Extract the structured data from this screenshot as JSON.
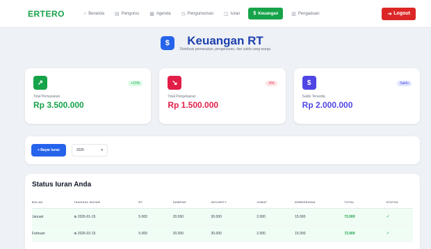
{
  "nav": {
    "brand": "ERTERO",
    "items": [
      {
        "icon": "⌂",
        "label": "Beranda"
      },
      {
        "icon": "▤",
        "label": "Pengurus"
      },
      {
        "icon": "▦",
        "label": "Agenda"
      },
      {
        "icon": "◷",
        "label": "Pengumuman"
      },
      {
        "icon": "◫",
        "label": "Iuran"
      },
      {
        "icon": "$",
        "label": "Keuangan"
      },
      {
        "icon": "▥",
        "label": "Pengaduan"
      }
    ],
    "logout": "Logout",
    "logout_icon": "⇥"
  },
  "header": {
    "icon": "$",
    "title": "Keuangan RT",
    "subtitle": "Distribusi pemasukan, pengeluaran, dan saldo uang warga"
  },
  "cards": [
    {
      "icon": "↗",
      "badge": "+15%",
      "label": "Total Pemasukan",
      "value": "Rp 3.500.000",
      "color": "#16a34a",
      "badge_bg": "#dcfce7"
    },
    {
      "icon": "↘",
      "badge": "-5%",
      "label": "Total Pengeluaran",
      "value": "Rp 1.500.000",
      "color": "#e11d48",
      "badge_bg": "#ffe4e6"
    },
    {
      "icon": "$",
      "badge": "Saldo",
      "label": "Saldo Tersedia",
      "value": "Rp 2.000.000",
      "color": "#4f46e5",
      "badge_bg": "#e0e7ff"
    }
  ],
  "toolbar": {
    "add_label": "+ Bayar Iuran",
    "year": "2026"
  },
  "table": {
    "title": "Status Iuran Anda",
    "headers": [
      "BULAN",
      "TANGGAL BAYAR",
      "RT",
      "SAMPAH",
      "SECURITY",
      "JUMAT",
      "KEBERSIHAN",
      "TOTAL",
      "STATUS"
    ],
    "rows": [
      {
        "cells": [
          "Januari",
          "⊕ 2026-01-15",
          "5.000",
          "20.000",
          "30.000",
          "2.000",
          "15.000",
          "72.000"
        ],
        "status": "✓"
      },
      {
        "cells": [
          "Februari",
          "⊕ 2026-02-15",
          "5.000",
          "20.000",
          "30.000",
          "2.000",
          "15.000",
          "72.000"
        ],
        "status": "✓"
      }
    ]
  }
}
